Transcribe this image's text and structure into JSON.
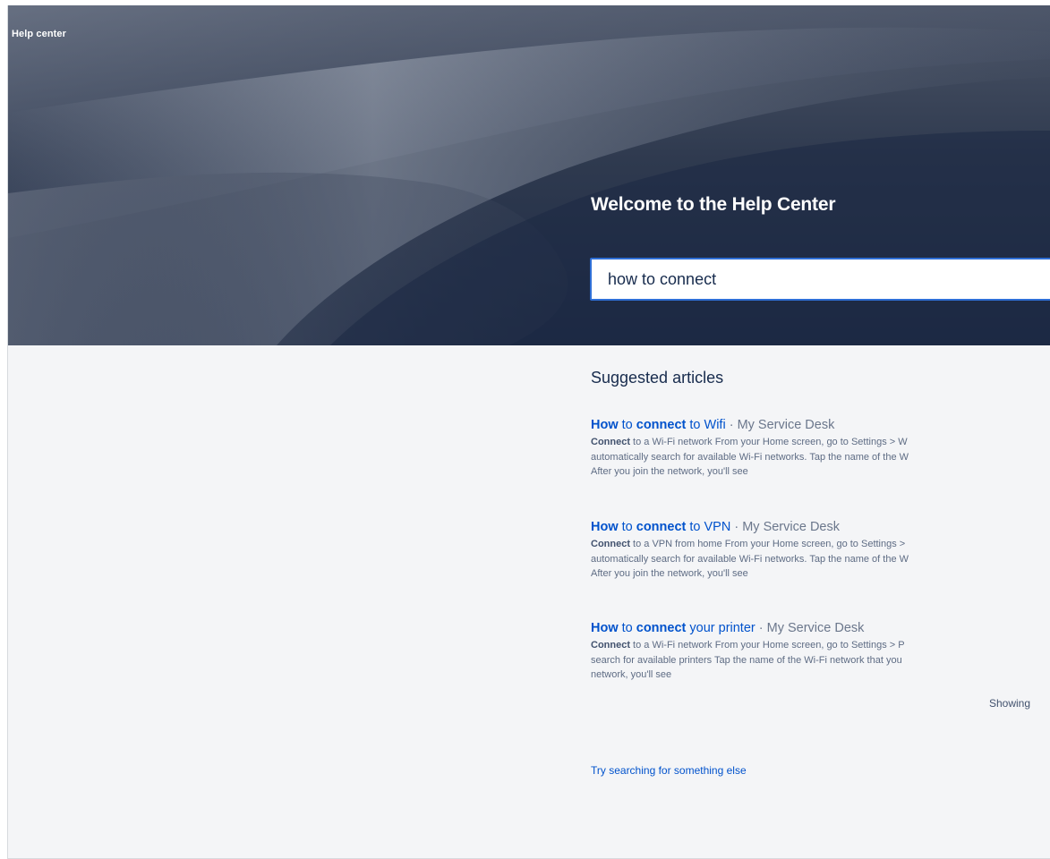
{
  "header": {
    "brand": "Help center",
    "title": "Welcome to the Help Center"
  },
  "search": {
    "value": "how to connect"
  },
  "results": {
    "heading": "Suggested articles",
    "articles": [
      {
        "title_parts": [
          "How",
          " to ",
          "connect",
          " to Wifi"
        ],
        "meta": "My Service Desk",
        "excerpt_bold": "Connect",
        "excerpt_line1": " to a Wi-Fi network From your Home screen, go to Settings > W",
        "excerpt_line2": "automatically search for available Wi-Fi networks. Tap the name of the W",
        "excerpt_line3": "After you join the network, you'll see"
      },
      {
        "title_parts": [
          "How",
          " to ",
          "connect",
          " to VPN"
        ],
        "meta": "My Service Desk",
        "excerpt_bold": "Connect",
        "excerpt_line1": " to a VPN from home From your Home screen, go to Settings >",
        "excerpt_line2": "automatically search for available Wi-Fi networks. Tap the name of the W",
        "excerpt_line3": "After you join the network, you'll see"
      },
      {
        "title_parts": [
          "How",
          " to ",
          "connect",
          " your printer"
        ],
        "meta": "My Service Desk",
        "excerpt_bold": "Connect",
        "excerpt_line1": " to a Wi-Fi network From your Home screen, go to Settings > P",
        "excerpt_line2": "search for available printers Tap the name of the Wi-Fi network that you",
        "excerpt_line3": "network, you'll see"
      }
    ],
    "showing_label": "Showing"
  },
  "footer": {
    "try_link": "Try searching for something else"
  },
  "colors": {
    "link": "#0052cc",
    "search_border": "#2f6fd6",
    "page_bg": "#f4f5f7",
    "hero_dark": "#1d2a44"
  }
}
